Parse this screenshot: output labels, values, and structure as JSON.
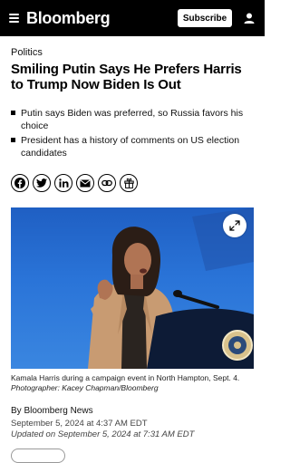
{
  "header": {
    "brand": "Bloomberg",
    "subscribe_label": "Subscribe",
    "icons": [
      "menu-icon",
      "user-icon"
    ]
  },
  "article": {
    "category": "Politics",
    "headline": "Smiling Putin Says He Prefers Harris to Trump Now Biden Is Out",
    "bullets": [
      "Putin says Biden was preferred, so Russia favors his choice",
      "President has a history of comments on US election candidates"
    ],
    "share_icons": [
      "facebook-icon",
      "twitter-icon",
      "linkedin-icon",
      "email-icon",
      "link-icon",
      "gift-icon"
    ],
    "image": {
      "caption": "Kamala Harris during a campaign event in North Hampton, Sept. 4.",
      "credit": "Photographer: Kacey Chapman/Bloomberg"
    },
    "byline": "By Bloomberg News",
    "published": "September 5, 2024 at 4:37 AM EDT",
    "updated": "Updated on September 5, 2024 at 7:31 AM EDT"
  },
  "colors": {
    "header_bg": "#000000",
    "sky": "#2a74d8"
  }
}
